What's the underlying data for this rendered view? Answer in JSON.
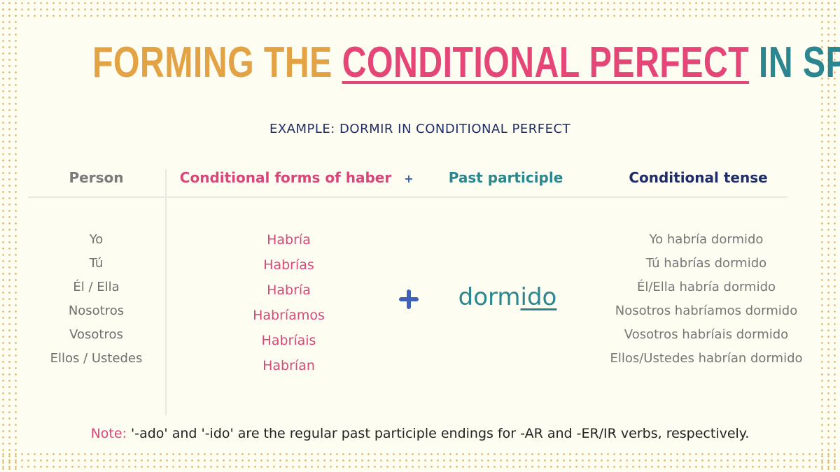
{
  "title": {
    "part1": "FORMING THE ",
    "part2": "CONDITIONAL PERFECT",
    "part3": " IN SPANISH"
  },
  "subtitle": "EXAMPLE: DORMIR IN CONDITIONAL PERFECT",
  "table": {
    "headers": {
      "person": "Person",
      "haber": "Conditional forms of haber",
      "plus": "+",
      "participle": "Past participle",
      "conditional": "Conditional tense"
    },
    "persons": [
      "Yo",
      "Tú",
      "Él / Ella",
      "Nosotros",
      "Vosotros",
      "Ellos / Ustedes"
    ],
    "haber_forms": [
      "Habría",
      "Habrías",
      "Habría",
      "Habríamos",
      "Habríais",
      "Habrían"
    ],
    "participle": {
      "stem": "dorm",
      "ending": "ido"
    },
    "conditional_forms": [
      "Yo habría dormido",
      "Tú habrías dormido",
      "Él/Ella habría dormido",
      "Nosotros habríamos dormido",
      "Vosotros habríais dormido",
      "Ellos/Ustedes habrían dormido"
    ]
  },
  "note": {
    "label": "Note:",
    "text": " '-ado' and '-ido' are the regular past participle endings for -AR and -ER/IR verbs, respectively."
  },
  "colors": {
    "background": "#fefdf2",
    "dots": "#e3b56a",
    "orange": "#e3a244",
    "pink": "#e44677",
    "teal": "#2b8690",
    "navy": "#1f2d66",
    "blue_plus": "#3f62b8",
    "gray": "#7a7a7a"
  }
}
